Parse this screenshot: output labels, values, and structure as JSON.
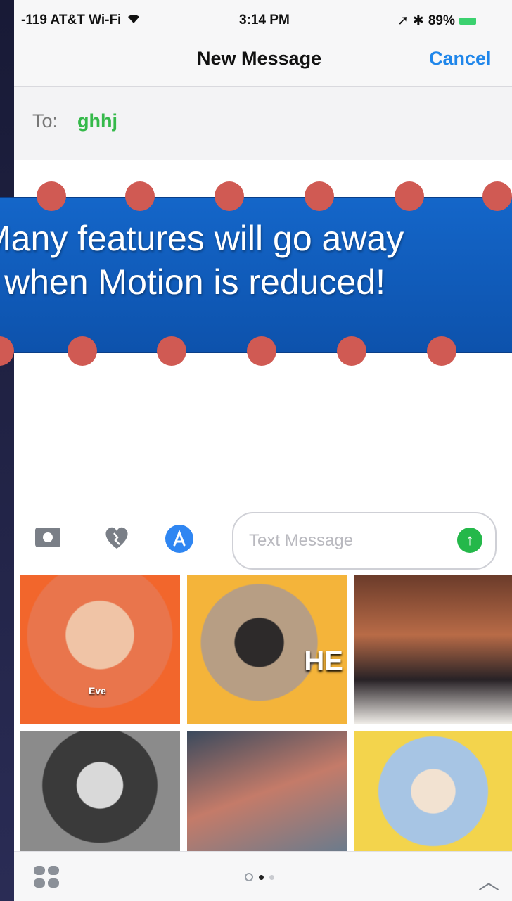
{
  "status_bar": {
    "carrier": "-119 AT&T Wi-Fi",
    "time": "3:14 PM",
    "battery": "89%"
  },
  "nav": {
    "title": "New Message",
    "cancel": "Cancel"
  },
  "to_field": {
    "label": "To:",
    "recipient": "ghhj"
  },
  "banner": {
    "line1": "Many features will go away",
    "line2": "when Motion is reduced!"
  },
  "input_bar": {
    "placeholder": "Text Message"
  },
  "gifs": {
    "items": [
      {
        "caption": "Eve"
      },
      {
        "caption": "HE"
      },
      {
        "caption": ""
      },
      {
        "caption": ""
      },
      {
        "caption": ""
      },
      {
        "caption": ""
      }
    ]
  },
  "colors": {
    "accent": "#1f86ea",
    "recipient": "#35b94a",
    "banner": "#1466c9",
    "dots": "#d05a53",
    "send": "#24b84a"
  },
  "icons": [
    "wifi-icon",
    "location-icon",
    "bluetooth-icon",
    "battery-icon",
    "camera-icon",
    "digital-touch-icon",
    "app-store-icon",
    "send-icon",
    "apps-grid-icon",
    "recent-icon",
    "chevron-up-icon"
  ]
}
